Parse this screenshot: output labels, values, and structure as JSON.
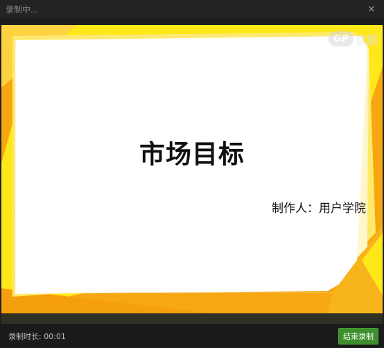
{
  "window": {
    "title": "录制中...",
    "close_symbol": "×"
  },
  "slide": {
    "title": "市场目标",
    "author_line": "制作人：用户学院",
    "watermark_logo_letters": "GP",
    "watermark_text": "优酷"
  },
  "status": {
    "duration_label": "录制时长:",
    "duration_value": "00:01",
    "end_button": "结束录制"
  },
  "colors": {
    "slide_orange": "#f6a712",
    "slide_yellow": "#ffe81a",
    "slide_white": "#ffffff",
    "button_green": "#3c8f2c"
  }
}
